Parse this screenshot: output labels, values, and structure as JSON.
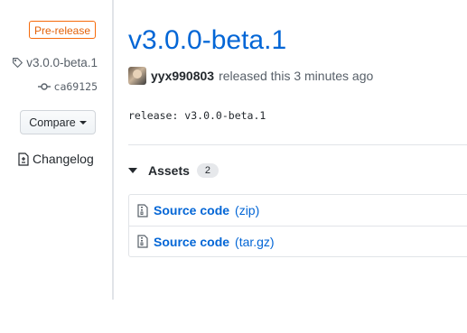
{
  "release": {
    "badge": "Pre-release",
    "tag": "v3.0.0-beta.1",
    "commit": "ca69125",
    "compare_label": "Compare",
    "changelog_label": "Changelog",
    "title": "v3.0.0-beta.1",
    "author": "yyx990803",
    "released_text": "released this 3 minutes ago",
    "body": "release: v3.0.0-beta.1"
  },
  "assets": {
    "label": "Assets",
    "count": "2",
    "items": [
      {
        "name": "Source code",
        "ext": "(zip)",
        "icon": "file-zip-icon"
      },
      {
        "name": "Source code",
        "ext": "(tar.gz)",
        "icon": "file-zip-icon"
      }
    ]
  },
  "colors": {
    "link": "#0366d6",
    "prerelease": "#e36209",
    "muted": "#586069",
    "border": "#e1e4e8"
  },
  "icons": {
    "tag": "tag-icon",
    "commit": "git-commit-icon",
    "changelog": "file-diff-icon",
    "caret": "triangle-down-icon",
    "archive": "file-zip-icon"
  }
}
